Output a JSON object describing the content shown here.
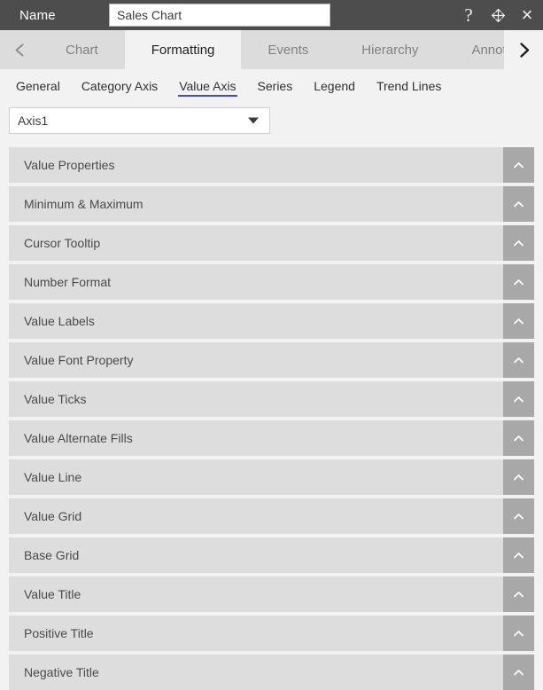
{
  "titlebar": {
    "name_label": "Name",
    "name_value": "Sales Chart",
    "name_placeholder": "Name",
    "help_icon": "?",
    "move_icon": "move-icon",
    "close_icon": "×"
  },
  "tabbar": {
    "prev_icon": "chevron-left-icon",
    "next_icon": "chevron-right-icon",
    "tabs": [
      {
        "label": "Chart",
        "active": false
      },
      {
        "label": "Formatting",
        "active": true
      },
      {
        "label": "Events",
        "active": false
      },
      {
        "label": "Hierarchy",
        "active": false
      },
      {
        "label": "Annotation",
        "active": false
      }
    ]
  },
  "subtabs": {
    "items": [
      {
        "label": "General",
        "active": false
      },
      {
        "label": "Category Axis",
        "active": false
      },
      {
        "label": "Value Axis",
        "active": true
      },
      {
        "label": "Series",
        "active": false
      },
      {
        "label": "Legend",
        "active": false
      },
      {
        "label": "Trend Lines",
        "active": false
      }
    ],
    "active_underline_color": "#3f51b5"
  },
  "axis_selector": {
    "value": "Axis1",
    "caret_icon": "triangle-down-icon"
  },
  "sections": {
    "toggle_icon": "chevron-up-icon",
    "items": [
      {
        "label": "Value Properties"
      },
      {
        "label": "Minimum & Maximum"
      },
      {
        "label": "Cursor Tooltip"
      },
      {
        "label": "Number Format"
      },
      {
        "label": "Value Labels"
      },
      {
        "label": "Value Font Property"
      },
      {
        "label": "Value Ticks"
      },
      {
        "label": "Value Alternate Fills"
      },
      {
        "label": "Value Line"
      },
      {
        "label": "Value Grid"
      },
      {
        "label": "Base Grid"
      },
      {
        "label": "Value Title"
      },
      {
        "label": "Positive Title"
      },
      {
        "label": "Negative Title"
      }
    ]
  },
  "colors": {
    "titlebar_bg": "#4d4d4d",
    "tabbar_bg": "#dcdcdc",
    "page_bg": "#f2f2f2",
    "row_bg": "#dddddd",
    "toggle_bg": "#a8a8a8",
    "accent": "#3f51b5"
  }
}
